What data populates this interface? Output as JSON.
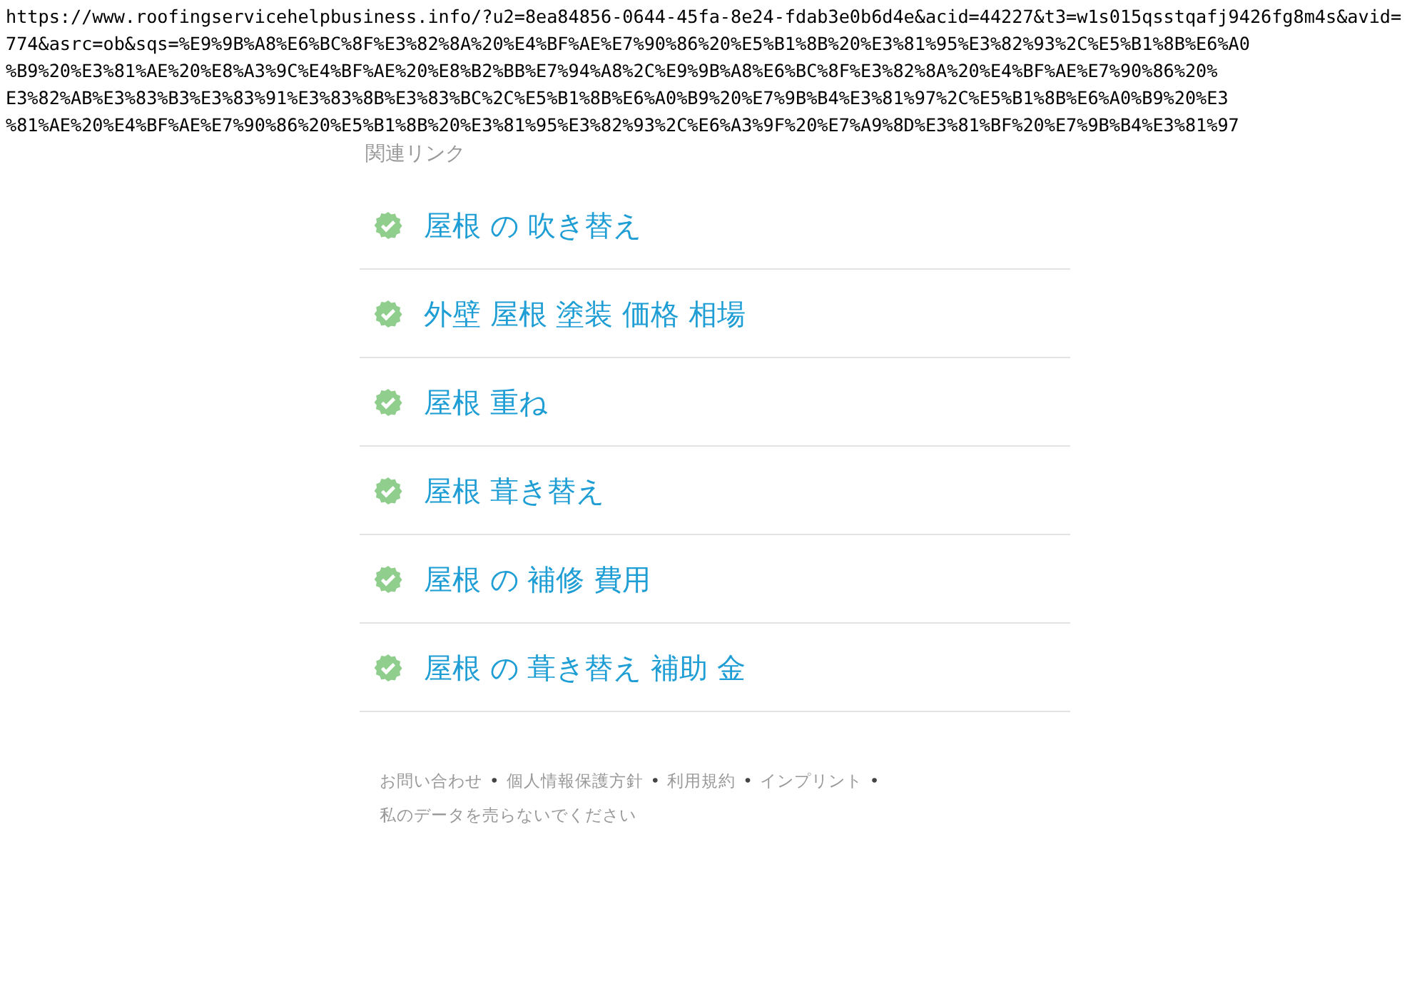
{
  "url_lines": [
    "https://www.roofingservicehelpbusiness.info/?u2=8ea84856-0644-45fa-8e24-fdab3e0b6d4e&acid=44227&t3=w1s015qsstqafj9426fg8m4s&avid=",
    "774&asrc=ob&sqs=%E9%9B%A8%E6%BC%8F%E3%82%8A%20%E4%BF%AE%E7%90%86%20%E5%B1%8B%20%E3%81%95%E3%82%93%2C%E5%B1%8B%E6%A0",
    "%B9%20%E3%81%AE%20%E8%A3%9C%E4%BF%AE%20%E8%B2%BB%E7%94%A8%2C%E9%9B%A8%E6%BC%8F%E3%82%8A%20%E4%BF%AE%E7%90%86%20%",
    "E3%82%AB%E3%83%B3%E3%83%91%E3%83%8B%E3%83%BC%2C%E5%B1%8B%E6%A0%B9%20%E7%9B%B4%E3%81%97%2C%E5%B1%8B%E6%A0%B9%20%E3",
    "%81%AE%20%E4%BF%AE%E7%90%86%20%E5%B1%8B%20%E3%81%95%E3%82%93%2C%E6%A3%9F%20%E7%A9%8D%E3%81%BF%20%E7%9B%B4%E3%81%97"
  ],
  "related": {
    "heading": "関連リンク",
    "links": [
      "屋根 の 吹き替え",
      "外壁 屋根 塗装 価格 相場",
      "屋根 重ね",
      "屋根 葺き替え",
      "屋根 の 補修 費用",
      "屋根 の 葺き替え 補助 金"
    ]
  },
  "footer": {
    "separator": "•",
    "links": [
      "お問い合わせ",
      "個人情報保護方針",
      "利用規約",
      "インプリント",
      "私のデータを売らないでください"
    ]
  }
}
